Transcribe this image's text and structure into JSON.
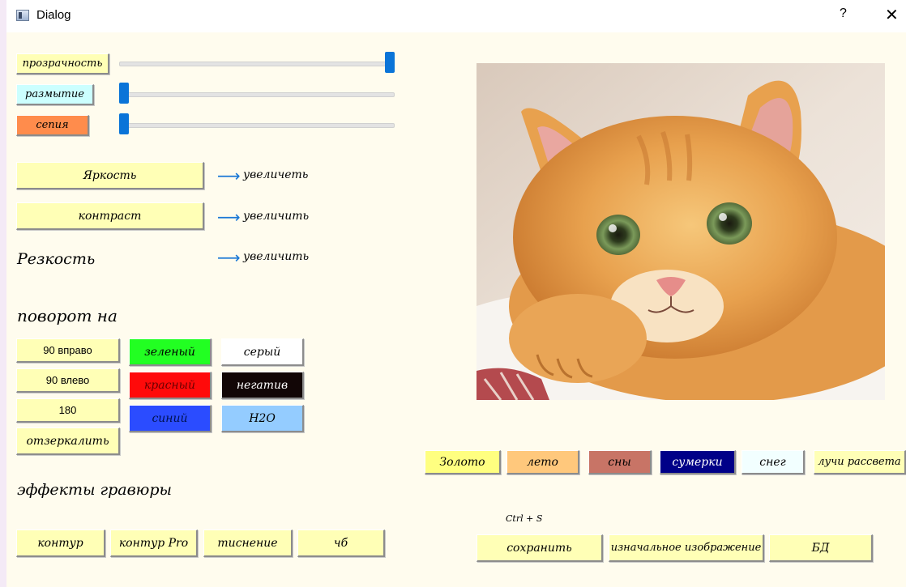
{
  "window": {
    "title": "Dialog",
    "help": "?",
    "close": "✕"
  },
  "sliders": {
    "opacity_label": "прозрачность",
    "opacity_value": 1.0,
    "blur_label": "размытие",
    "blur_value": 0.0,
    "sepia_label": "сепия",
    "sepia_value": 0.0
  },
  "adjust": {
    "brightness_label": "Яркость",
    "brightness_action": "увеличеть",
    "contrast_label": "контраст",
    "contrast_action": "увеличить",
    "sharpness_label": "Резкость",
    "sharpness_action": "увеличить"
  },
  "rotate": {
    "heading": "поворот на",
    "right": "90 вправо",
    "left": "90 влево",
    "r180": "180",
    "mirror": "отзеркалить"
  },
  "color_filters": {
    "green": "зеленый",
    "red": "красный",
    "blue": "синий",
    "gray": "серый",
    "negative": "негатив",
    "h2o": "H2O"
  },
  "engraving": {
    "heading": "эффекты гравюры",
    "contour": "контур",
    "contour_pro": "контур Pro",
    "emboss": "тиснение",
    "bw": "чб"
  },
  "presets": {
    "gold": "Золото",
    "summer": "лето",
    "dreams": "сны",
    "twilight": "сумерки",
    "snow": "снег",
    "dawn_rays": "лучи рассвета"
  },
  "file": {
    "shortcut": "Ctrl + S",
    "save": "сохранить",
    "original": "изначальное изображение",
    "db": "БД"
  },
  "colors": {
    "window_bg": "#fffcee",
    "button_yellow": "#ffffb6",
    "accent_blue": "#0a74d8",
    "green": "#22ff22",
    "red": "#ff0a0a",
    "blue": "#2b4cff",
    "negative": "#120606",
    "h2o": "#94ccff",
    "blur_btn": "#ccffff",
    "sepia_btn": "#ff8c4c",
    "gold": "#ffff80",
    "summer": "#ffc87c",
    "dreams": "#c87466",
    "twilight": "#000088",
    "snow": "#f2ffff"
  }
}
